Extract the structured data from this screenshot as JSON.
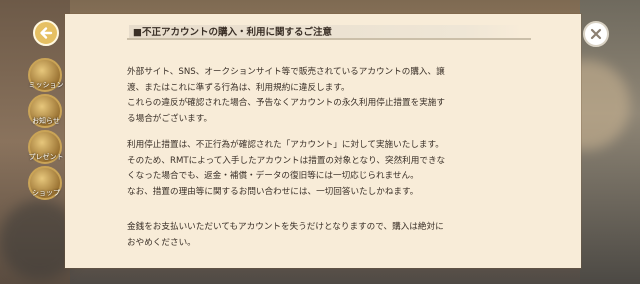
{
  "sidebar": {
    "items": [
      {
        "label": "ミッション",
        "icon": "mission-icon"
      },
      {
        "label": "お知らせ",
        "icon": "notice-icon"
      },
      {
        "label": "プレゼント",
        "icon": "present-icon"
      },
      {
        "label": "ショップ",
        "icon": "shop-icon"
      }
    ]
  },
  "dialog": {
    "title": "■不正アカウントの購入・利用に関するご注意",
    "paragraphs": [
      [
        "外部サイト、SNS、オークションサイト等で販売されているアカウントの購入、譲",
        "渡、またはこれに準ずる行為は、利用規約に違反します。",
        "これらの違反が確認された場合、予告なくアカウントの永久利用停止措置を実施す",
        "る場合がございます。"
      ],
      [
        "利用停止措置は、不正行為が確認された「アカウント」に対して実施いたします。",
        "そのため、RMTによって入手したアカウントは措置の対象となり、突然利用できな",
        "くなった場合でも、返金・補償・データの復旧等には一切応じられません。",
        "なお、措置の理由等に関するお問い合わせには、一切回答いたしかねます。"
      ],
      [
        "金銭をお支払いいただいてもアカウントを失うだけとなりますので、購入は絶対に",
        "おやめください。"
      ]
    ]
  },
  "colors": {
    "dialog_bg": "#f8ecd8",
    "back_button": "#e6c063",
    "text": "#3a3028"
  },
  "icons": {
    "back": "arrow-left-icon",
    "close": "close-icon"
  }
}
